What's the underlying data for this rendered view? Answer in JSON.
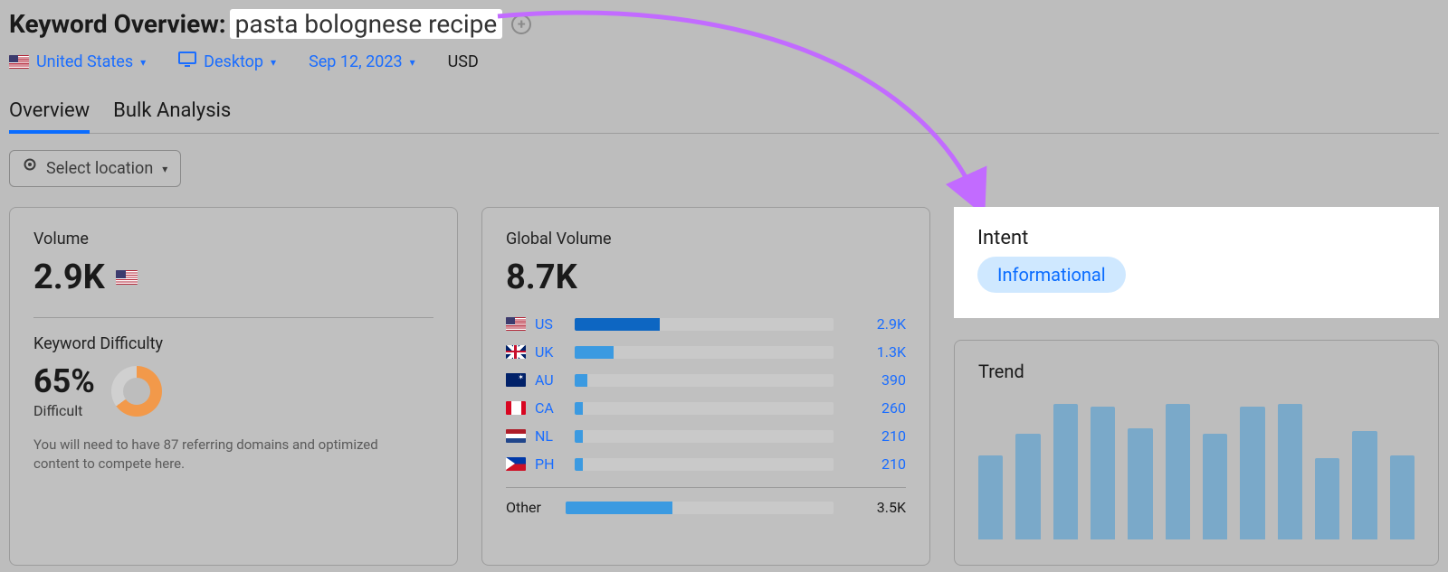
{
  "header": {
    "title_prefix": "Keyword Overview:",
    "keyword": "pasta bolognese recipe"
  },
  "filters": {
    "country": "United States",
    "device": "Desktop",
    "date": "Sep 12, 2023",
    "currency": "USD"
  },
  "tabs": {
    "overview": "Overview",
    "bulk": "Bulk Analysis"
  },
  "location_selector": "Select location",
  "volume_card": {
    "label": "Volume",
    "value": "2.9K",
    "kd_label": "Keyword Difficulty",
    "kd_pct": "65%",
    "kd_level": "Difficult",
    "kd_note": "You will need to have 87 referring domains and optimized content to compete here."
  },
  "global_volume_card": {
    "label": "Global Volume",
    "value": "8.7K",
    "rows": [
      {
        "code": "US",
        "flag": "us",
        "value": "2.9K",
        "pct": 33,
        "dark": true
      },
      {
        "code": "UK",
        "flag": "uk",
        "value": "1.3K",
        "pct": 15,
        "dark": false
      },
      {
        "code": "AU",
        "flag": "au",
        "value": "390",
        "pct": 5,
        "dark": false
      },
      {
        "code": "CA",
        "flag": "ca",
        "value": "260",
        "pct": 3,
        "dark": false
      },
      {
        "code": "NL",
        "flag": "nl",
        "value": "210",
        "pct": 3,
        "dark": false
      },
      {
        "code": "PH",
        "flag": "ph",
        "value": "210",
        "pct": 3,
        "dark": false
      }
    ],
    "other_label": "Other",
    "other_value": "3.5K",
    "other_pct": 40
  },
  "intent_card": {
    "label": "Intent",
    "value": "Informational"
  },
  "trend_card": {
    "label": "Trend"
  },
  "chart_data": {
    "type": "bar",
    "title": "Trend",
    "xlabel": "",
    "ylabel": "",
    "categories": [
      "1",
      "2",
      "3",
      "4",
      "5",
      "6",
      "7",
      "8",
      "9",
      "10",
      "11",
      "12"
    ],
    "values": [
      62,
      78,
      100,
      98,
      82,
      100,
      78,
      98,
      100,
      60,
      80,
      62
    ],
    "ylim": [
      0,
      100
    ]
  },
  "annotation": {
    "color": "#c26bff"
  }
}
